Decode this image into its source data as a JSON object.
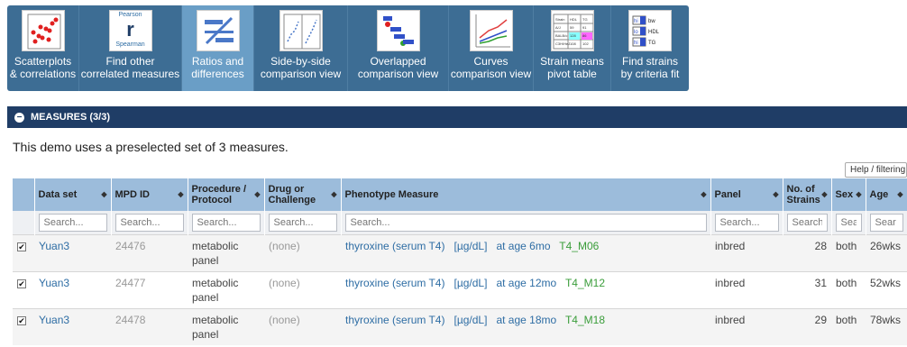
{
  "toolbar": [
    {
      "line1": "Scatterplots",
      "line2": "& correlations",
      "icon": "scatterplot-icon",
      "active": false
    },
    {
      "line1": "Find other",
      "line2": "correlated measures",
      "icon": "correlation-icon",
      "active": false
    },
    {
      "line1": "Ratios and",
      "line2": "differences",
      "icon": "ratio-icon",
      "active": true
    },
    {
      "line1": "Side-by-side",
      "line2": "comparison view",
      "icon": "side-by-side-icon",
      "active": false
    },
    {
      "line1": "Overlapped",
      "line2": "comparison view",
      "icon": "overlapped-icon",
      "active": false
    },
    {
      "line1": "Curves",
      "line2": "comparison view",
      "icon": "curves-icon",
      "active": false
    },
    {
      "line1": "Strain means",
      "line2": "pivot table",
      "icon": "pivot-table-icon",
      "active": false
    },
    {
      "line1": "Find strains",
      "line2": "by criteria fit",
      "icon": "criteria-icon",
      "active": false
    }
  ],
  "icons": {
    "pearson": "Pearson",
    "r": "r",
    "spearman": "Spearman",
    "pivot": [
      "Strain",
      "HDL",
      "TG",
      "A/J",
      "BALB/c",
      "C3H/HeJ",
      "59",
      "91",
      "128",
      "86",
      "108",
      "102"
    ],
    "criteria": [
      "hi",
      "bw",
      "lo",
      "HDL",
      "hi",
      "TG"
    ]
  },
  "section": {
    "title": "MEASURES (3/3)"
  },
  "demo_text": "This demo uses a preselected set of 3 measures.",
  "help_button": "Help / filtering",
  "table": {
    "headers": [
      "Data set",
      "MPD ID",
      "Procedure / Protocol",
      "Drug or Challenge",
      "Phenotype Measure",
      "Panel",
      "No. of Strains",
      "Sex",
      "Age"
    ],
    "search_placeholders": [
      "Search...",
      "Search...",
      "Search...",
      "Search...",
      "Search...",
      "Search...",
      "Search",
      "Sea",
      "Sear"
    ],
    "rows": [
      {
        "dataset": "Yuan3",
        "mpd_id": "24476",
        "procedure": "metabolic panel",
        "drug": "(none)",
        "measure": "thyroxine (serum T4)",
        "unit": "[µg/dL]",
        "age_text": "at age 6mo",
        "code": "T4_M06",
        "panel": "inbred",
        "strains": "28",
        "sex": "both",
        "age": "26wks"
      },
      {
        "dataset": "Yuan3",
        "mpd_id": "24477",
        "procedure": "metabolic panel",
        "drug": "(none)",
        "measure": "thyroxine (serum T4)",
        "unit": "[µg/dL]",
        "age_text": "at age 12mo",
        "code": "T4_M12",
        "panel": "inbred",
        "strains": "31",
        "sex": "both",
        "age": "52wks"
      },
      {
        "dataset": "Yuan3",
        "mpd_id": "24478",
        "procedure": "metabolic panel",
        "drug": "(none)",
        "measure": "thyroxine (serum T4)",
        "unit": "[µg/dL]",
        "age_text": "at age 18mo",
        "code": "T4_M18",
        "panel": "inbred",
        "strains": "29",
        "sex": "both",
        "age": "78wks"
      }
    ]
  },
  "colors": {
    "toolbar": "#3d6d94",
    "toolbar_active": "#6a9ec6",
    "section": "#1f3d66",
    "header": "#9cbcdb",
    "link": "#2e6da4",
    "code": "#3a9d3a"
  }
}
